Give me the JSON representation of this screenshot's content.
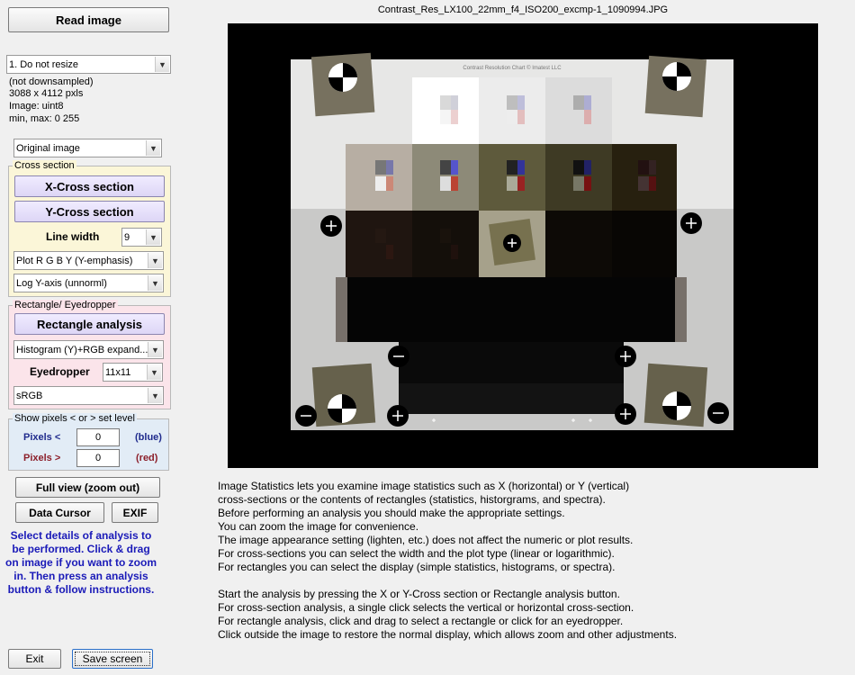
{
  "left_panel": {
    "read_image_label": "Read image",
    "resize_select": "1. Do not resize",
    "info": [
      "(not downsampled)",
      "3088 x 4112 pxls",
      "Image:   uint8",
      "min, max:  0  255"
    ],
    "display_select": "Original image",
    "cross_section": {
      "title": "Cross section",
      "x_button": "X-Cross section",
      "y_button": "Y-Cross section",
      "line_width_label": "Line width",
      "line_width_value": "9",
      "plot_select": "Plot R G B Y (Y-emphasis)",
      "axis_select": "Log Y-axis (unnorml)"
    },
    "rectangle": {
      "title": "Rectangle/ Eyedropper",
      "button": "Rectangle analysis",
      "display_select": "Histogram (Y)+RGB expand...",
      "eyedropper_label": "Eyedropper",
      "eyedropper_value": "11x11",
      "colorspace_select": "sRGB"
    },
    "pixels": {
      "title": "Show pixels < or > set level",
      "less_label": "Pixels <",
      "less_value": "0",
      "less_color": "(blue)",
      "greater_label": "Pixels >",
      "greater_value": "0",
      "greater_color": "(red)"
    },
    "full_view_label": "Full view (zoom out)",
    "data_cursor_label": "Data Cursor",
    "exif_label": "EXIF",
    "instructions": "Select details of analysis to be performed. Click & drag on image if you want to zoom in. Then press an analysis button & follow instructions.",
    "exit_label": "Exit",
    "save_label": "Save screen"
  },
  "image_title": "Contrast_Res_LX100_22mm_f4_ISO200_excmp-1_1090994.JPG",
  "chart_header_text": "Contrast Resolution Chart © Imatest LLC",
  "description": [
    "Image Statistics lets you examine image statistics such as X (horizontal) or Y (vertical)",
    "cross-sections or the contents of rectangles (statistics, historgrams, and spectra).",
    "Before performing an analysis you should make the appropriate settings.",
    "You can zoom the image for convenience.",
    "The image appearance setting (lighten, etc.) does not affect the numeric or plot results.",
    "For cross-sections you can select the width and the plot type (linear or logarithmic).",
    "For rectangles you can select the display (simple statistics, histograms, or spectra).",
    "",
    "Start the analysis by pressing the X or Y-Cross section or Rectangle analysis button.",
    "For cross-section analysis, a single click selects the vertical or horizontal cross-section.",
    "For rectangle analysis, click and drag to select a rectangle or click for an eyedropper.",
    "Click outside the image to restore the normal display, which allows zoom and other adjustments."
  ],
  "colors": {
    "cross_section_bg": "#fbf6d8",
    "rectangle_bg": "#fbe4ea",
    "pixels_bg": "#e2ecf6",
    "instruction_text": "#1a1ab8",
    "image_bg": "#000000"
  }
}
